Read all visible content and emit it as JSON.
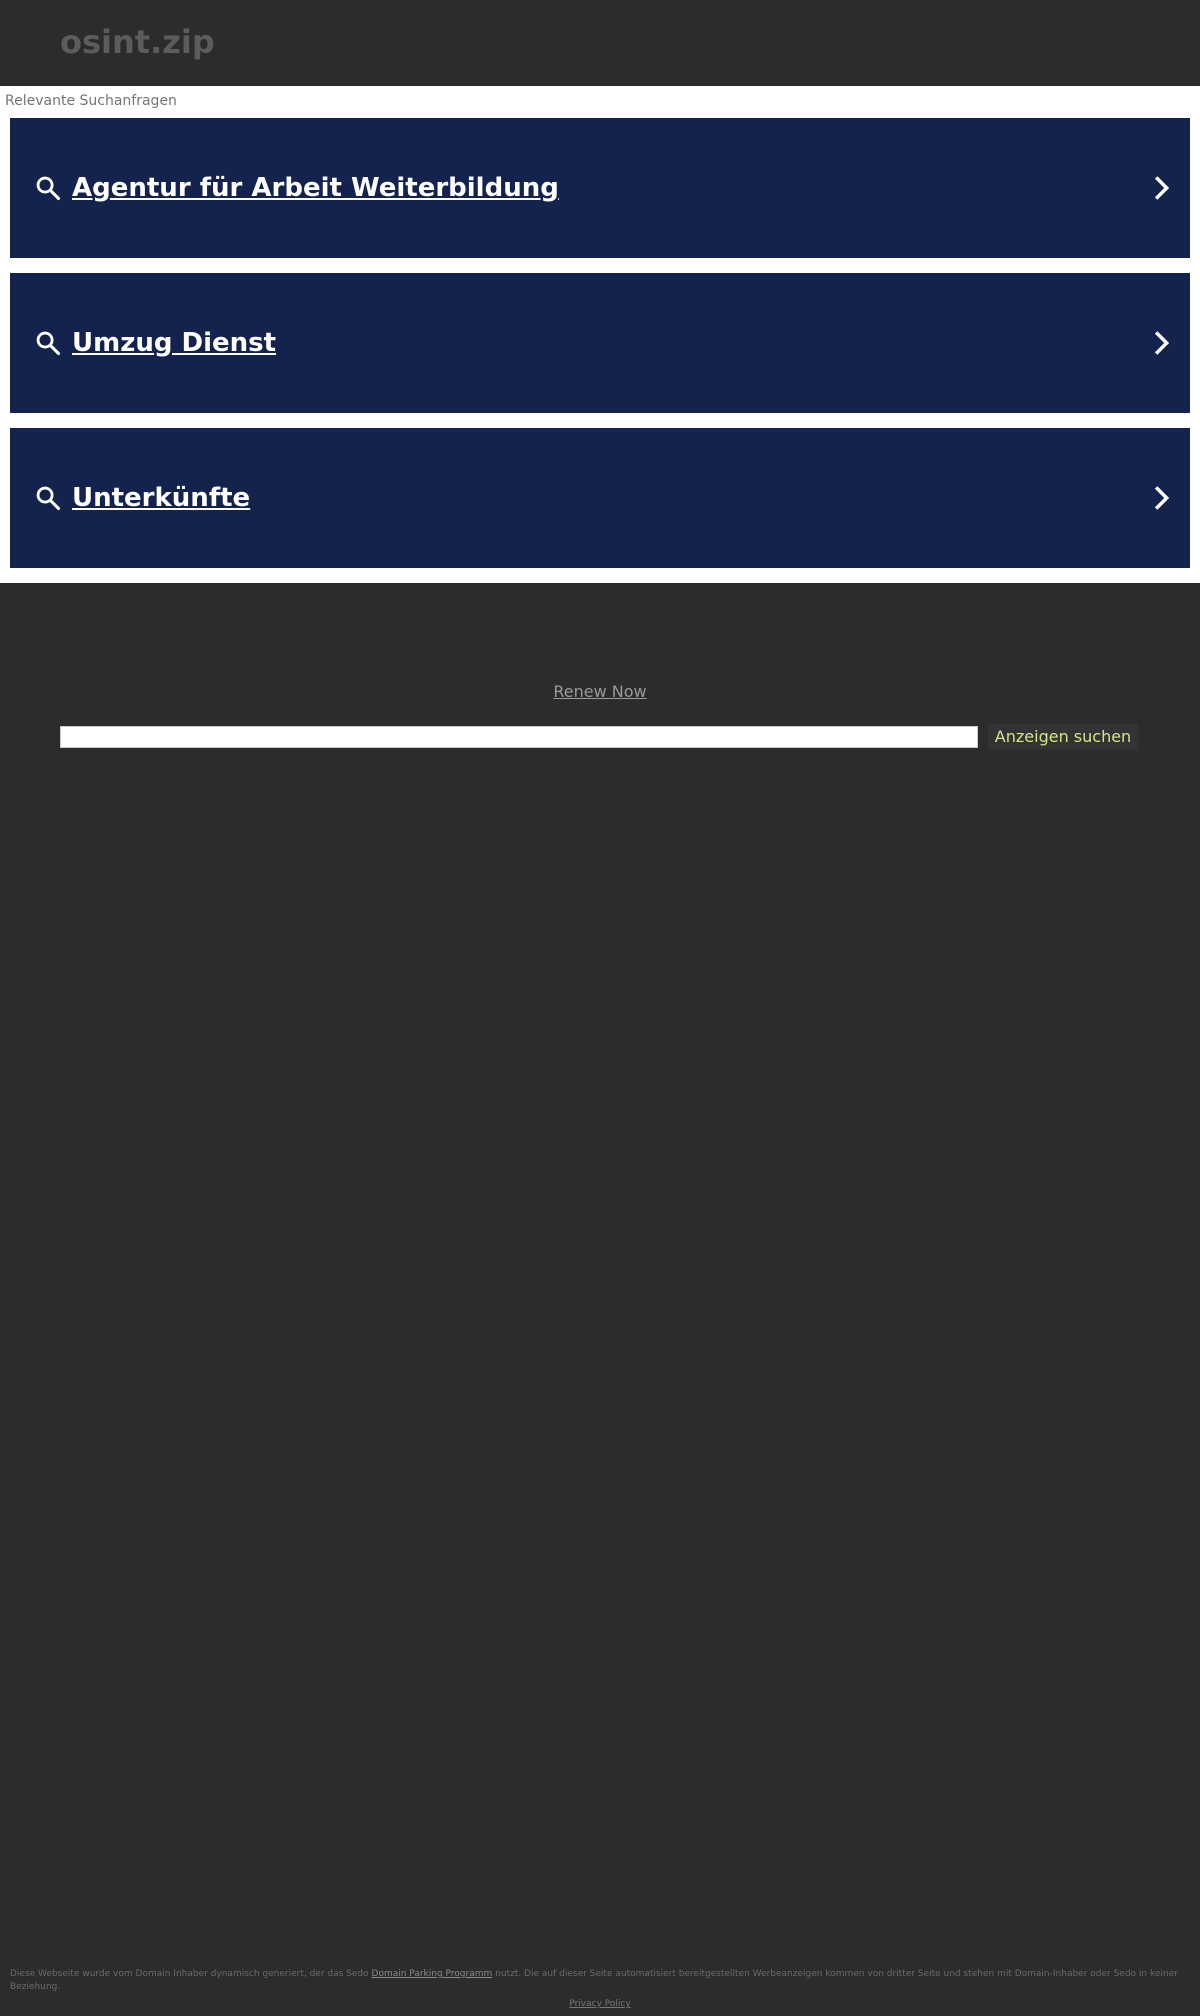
{
  "header": {
    "domain_title": "osint.zip"
  },
  "ads": {
    "caption": "Relevante Suchanfragen",
    "items": [
      {
        "label": "Agentur für Arbeit Weiterbildung"
      },
      {
        "label": "Umzug Dienst"
      },
      {
        "label": "Unterkünfte"
      }
    ]
  },
  "renew": {
    "label": "Renew Now"
  },
  "search": {
    "value": "",
    "button_label": "Anzeigen suchen"
  },
  "footer": {
    "text_before": "Diese Webseite wurde vom Domain Inhaber dynamisch generiert, der das Sedo ",
    "link_label": "Domain Parking Programm",
    "text_after": " nutzt. Die auf dieser Seite automatisiert bereitgestellten Werbeanzeigen kommen von dritter Seite und stehen mit Domain-Inhaber oder Sedo in keiner Beziehung.",
    "privacy_label": "Privacy Policy"
  },
  "colors": {
    "background": "#2c2c2c",
    "ad_background": "#13234d",
    "button_text": "#d3e78b"
  }
}
